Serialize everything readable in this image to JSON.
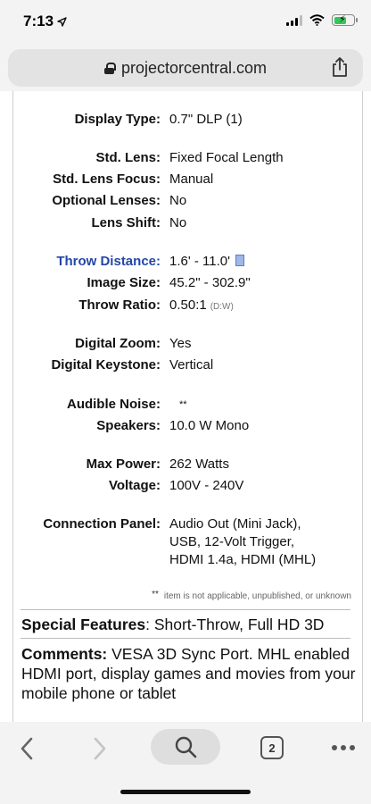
{
  "status_bar": {
    "time": "7:13",
    "location_icon": "location-arrow-icon",
    "signal_icon": "cellular-signal-icon",
    "wifi_icon": "wifi-icon",
    "battery_icon": "battery-charging-icon",
    "battery_color": "#34c759"
  },
  "browser": {
    "url": "projectorcentral.com",
    "lock_icon": "lock-icon",
    "share_icon": "share-icon"
  },
  "specs": {
    "display_type": {
      "label": "Display Type:",
      "value": "0.7\" DLP (1)"
    },
    "std_lens": {
      "label": "Std. Lens:",
      "value": "Fixed Focal Length"
    },
    "std_lens_focus": {
      "label": "Std. Lens Focus:",
      "value": "Manual"
    },
    "optional_lenses": {
      "label": "Optional Lenses:",
      "value": "No"
    },
    "lens_shift": {
      "label": "Lens Shift:",
      "value": "No"
    },
    "throw_distance": {
      "label": "Throw Distance:",
      "value": "1.6' - 11.0'",
      "link_color": "#2446a8"
    },
    "image_size": {
      "label": "Image Size:",
      "value": "45.2\" - 302.9\""
    },
    "throw_ratio": {
      "label": "Throw Ratio:",
      "value": "0.50:1",
      "note": "(D:W)"
    },
    "digital_zoom": {
      "label": "Digital Zoom:",
      "value": "Yes"
    },
    "digital_keystone": {
      "label": "Digital Keystone:",
      "value": "Vertical"
    },
    "audible_noise": {
      "label": "Audible Noise:",
      "value": "**"
    },
    "speakers": {
      "label": "Speakers:",
      "value": "10.0 W Mono"
    },
    "max_power": {
      "label": "Max Power:",
      "value": "262 Watts"
    },
    "voltage": {
      "label": "Voltage:",
      "value": "100V - 240V"
    },
    "connection_panel": {
      "label": "Connection Panel:",
      "lines": [
        "Audio Out (Mini Jack),",
        "USB,  12-Volt Trigger,",
        "HDMI 1.4a,  HDMI (MHL)"
      ]
    }
  },
  "footnote": {
    "marker": "**",
    "text": "item is not applicable, unpublished, or unknown"
  },
  "special_features": {
    "label": "Special Features",
    "value": ": Short-Throw, Full HD 3D"
  },
  "comments": {
    "label": "Comments:",
    "value": " VESA 3D Sync Port. MHL enabled HDMI port, display games and movies from your mobile phone or tablet"
  },
  "toolbar": {
    "back_icon": "chevron-left-icon",
    "forward_icon": "chevron-right-icon",
    "search_icon": "search-icon",
    "tab_count": "2",
    "more_icon": "more-dots-icon"
  }
}
